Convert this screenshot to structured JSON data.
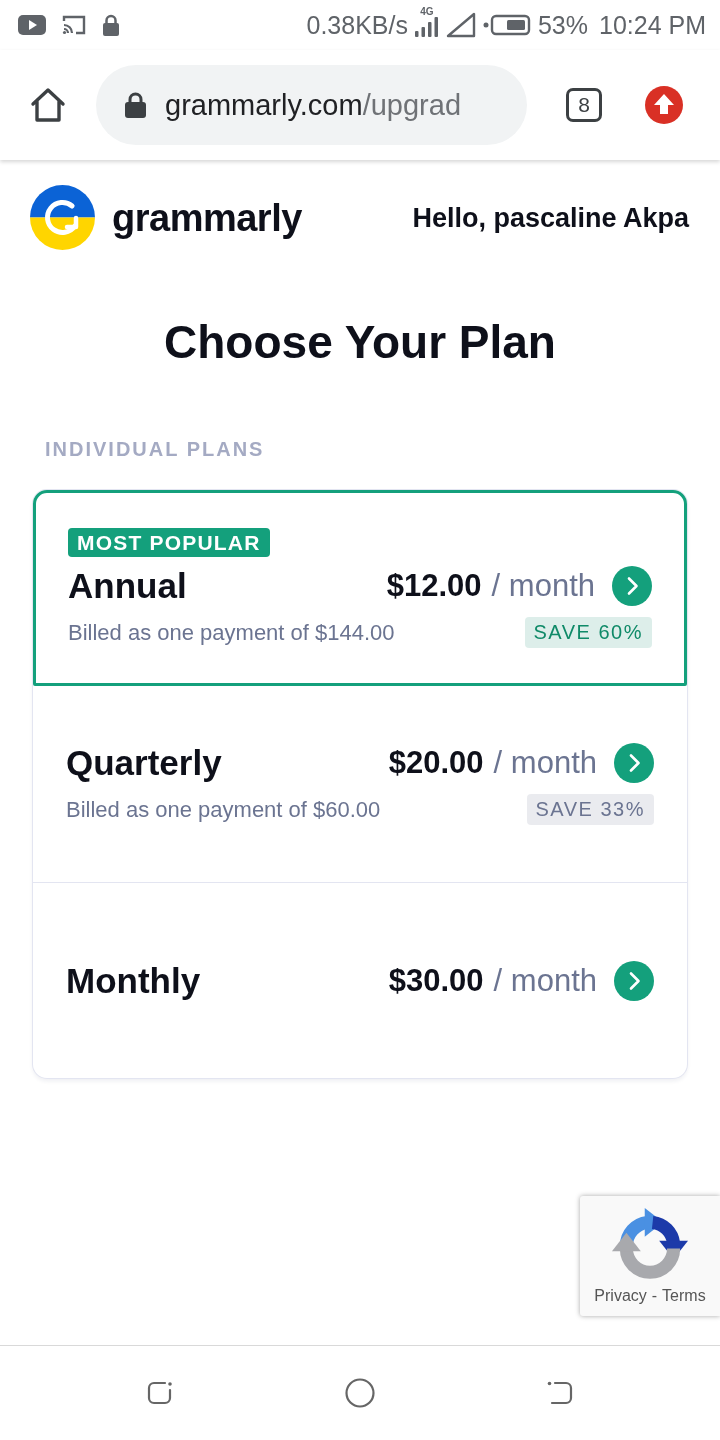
{
  "status_bar": {
    "network_speed": "0.38KB/s",
    "network_type": "4G",
    "battery": "53%",
    "time": "10:24 PM"
  },
  "browser": {
    "url_host": "grammarly.com",
    "url_path": "/upgrad",
    "tab_count": "8"
  },
  "header": {
    "logo": "grammarly",
    "greeting": "Hello, pascaline Akpa"
  },
  "title": "Choose Your Plan",
  "section_label": "INDIVIDUAL PLANS",
  "plans": [
    {
      "badge": "MOST POPULAR",
      "name": "Annual",
      "price": "$12.00",
      "period": "/ month",
      "billing": "Billed as one payment of $144.00",
      "save": {
        "text": "SAVE 60%",
        "color": "#0f8a68"
      },
      "selected": true
    },
    {
      "name": "Quarterly",
      "price": "$20.00",
      "period": "/ month",
      "billing": "Billed as one payment of $60.00",
      "save": {
        "text": "SAVE 33%",
        "color": "#6b7491"
      },
      "selected": false
    },
    {
      "name": "Monthly",
      "price": "$30.00",
      "period": "/ month",
      "selected": false
    }
  ],
  "recaptcha": {
    "privacy": "Privacy",
    "separator": "-",
    "terms": "Terms"
  }
}
